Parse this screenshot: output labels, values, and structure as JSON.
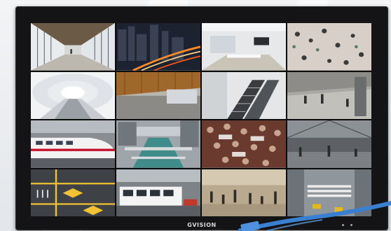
{
  "brand": "GVISION",
  "colors": {
    "bezel": "#141416",
    "cable": "#3b7fd0",
    "background": "#eef0f2"
  },
  "grid": {
    "rows": 4,
    "columns": 4,
    "tiles": [
      "subway-corridor",
      "night-city-traffic",
      "office-interior",
      "aerial-crowd-plaza",
      "white-tunnel",
      "wood-ceiling-lobby",
      "escalators",
      "train-platform",
      "bullet-train",
      "city-canal",
      "crowded-cafeteria",
      "market-hall",
      "road-intersection",
      "city-bus",
      "busy-concourse",
      "street-crosswalk"
    ]
  }
}
